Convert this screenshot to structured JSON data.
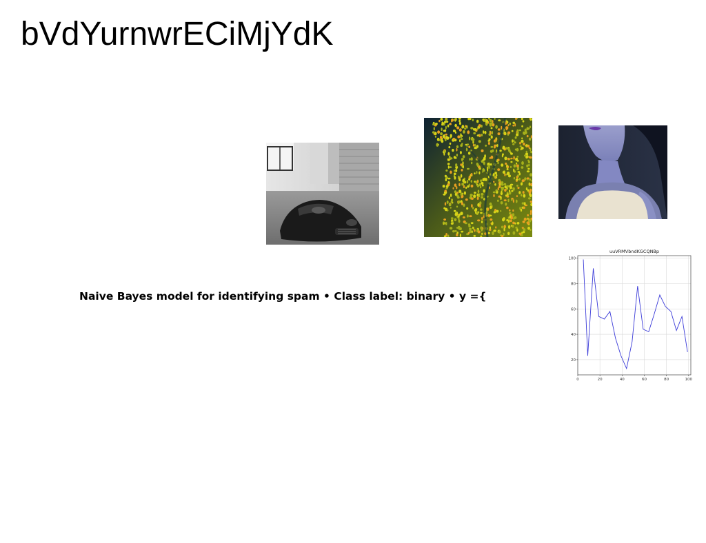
{
  "page": {
    "title": "bVdYurnwrECiMjYdK",
    "bullet_text": "Naive Bayes model for identifying spam • Class label: binary • y ={"
  },
  "images": [
    {
      "name": "car-photo",
      "description_icon": "black-sports-car-photo"
    },
    {
      "name": "texture-photo",
      "description_icon": "yellow-dots-texture-photo"
    },
    {
      "name": "portrait-photo",
      "description_icon": "woman-portrait-photo"
    }
  ],
  "colors": {
    "line": "#3a3ad8",
    "grid": "#d9d9d9",
    "background": "#ffffff"
  },
  "chart_data": {
    "type": "line",
    "title": "uuVRMVbndKGCQNBp",
    "xlabel": "",
    "ylabel": "",
    "xlim": [
      0,
      102
    ],
    "ylim": [
      8,
      102
    ],
    "xticks": [
      0,
      20,
      40,
      60,
      80,
      100
    ],
    "yticks": [
      20,
      40,
      60,
      80,
      100
    ],
    "grid": true,
    "x": [
      5,
      9,
      14,
      19,
      24,
      29,
      34,
      39,
      44,
      49,
      54,
      59,
      64,
      69,
      74,
      79,
      84,
      89,
      94,
      99
    ],
    "series": [
      {
        "values": [
          99,
          23,
          92,
          54,
          52,
          58,
          37,
          23,
          13,
          34,
          78,
          44,
          42,
          56,
          71,
          62,
          58,
          43,
          54,
          26
        ]
      }
    ]
  }
}
